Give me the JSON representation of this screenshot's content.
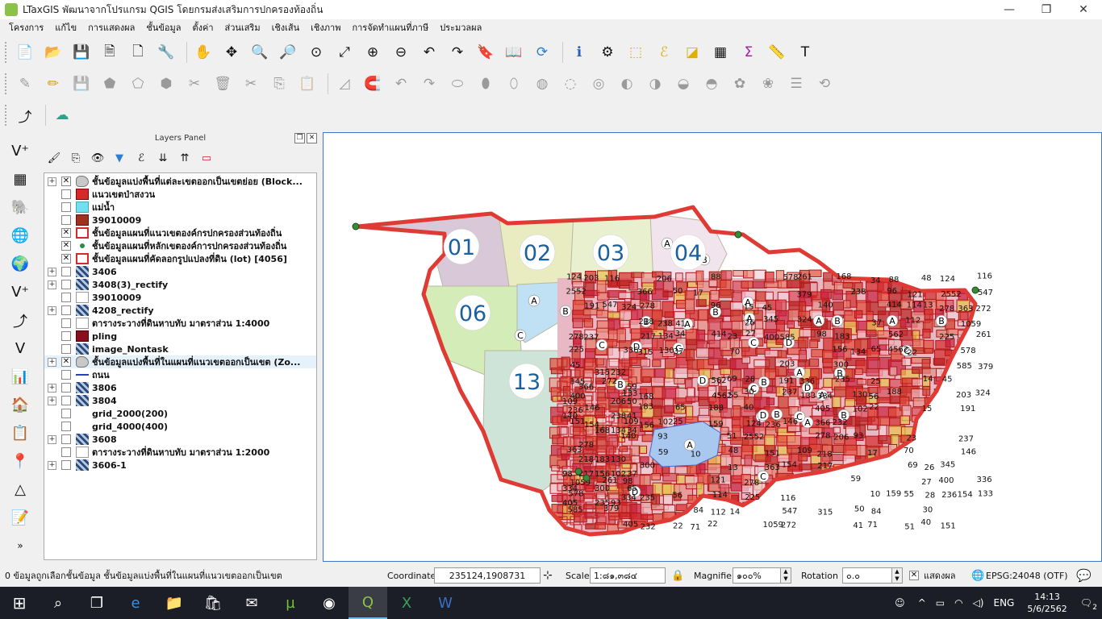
{
  "window": {
    "title": "LTaxGIS พัฒนาจากโปรแกรม QGIS โดยกรมส่งเสริมการปกครองท้องถิ่น",
    "minimize": "—",
    "maximize": "❐",
    "close": "✕"
  },
  "menu": [
    "โครงการ",
    "แก้ไข",
    "การแสดงผล",
    "ชั้นข้อมูล",
    "ตั้งค่า",
    "ส่วนเสริม",
    "เชิงเส้น",
    "เชิงภาพ",
    "การจัดทำแผนที่ภาษี",
    "ประมวลผล"
  ],
  "layers_panel": {
    "title": "Layers Panel",
    "float_btn": "❐",
    "close_btn": "✕",
    "layers": [
      {
        "name": "ชั้นข้อมูลแบ่งพื้นที่แต่ละเขตออกเป็นเขตย่อย (Block...",
        "checked": true,
        "expandable": true,
        "symbol": "polygon-gray"
      },
      {
        "name": "แนวเขตป่าสงวน",
        "checked": false,
        "expandable": false,
        "symbol": "fill-red"
      },
      {
        "name": "แม่น้ำ",
        "checked": false,
        "expandable": false,
        "symbol": "fill-cyan"
      },
      {
        "name": "39010009",
        "checked": false,
        "expandable": false,
        "symbol": "fill-darkred"
      },
      {
        "name": "ชั้นข้อมูลแผนที่แนวเขตองค์กรปกครองส่วนท้องถิ่น",
        "checked": true,
        "expandable": false,
        "symbol": "outline-red"
      },
      {
        "name": "ชั้นข้อมูลแผนที่หลักเขตองค์การปกครองส่วนท้องถิ่น",
        "checked": true,
        "expandable": false,
        "symbol": "dot-green"
      },
      {
        "name": "ชั้นข้อมูลแผนที่คัดลอกรูปแปลงที่ดิน (lot) [4056]",
        "checked": true,
        "expandable": false,
        "symbol": "outline-red"
      },
      {
        "name": "3406",
        "checked": false,
        "expandable": true,
        "symbol": "raster"
      },
      {
        "name": "3408(3)_rectify",
        "checked": false,
        "expandable": true,
        "symbol": "raster"
      },
      {
        "name": "39010009",
        "checked": false,
        "expandable": false,
        "symbol": "fill-white"
      },
      {
        "name": "4208_rectify",
        "checked": false,
        "expandable": true,
        "symbol": "raster"
      },
      {
        "name": "ตารางระวางที่ดินหาบทับ มาตราส่วน 1:4000",
        "checked": false,
        "expandable": false,
        "symbol": "fill-white"
      },
      {
        "name": "pling",
        "checked": false,
        "expandable": false,
        "symbol": "fill-maroon"
      },
      {
        "name": "image_Nontask",
        "checked": false,
        "expandable": false,
        "symbol": "raster"
      },
      {
        "name": "ชั้นข้อมูลแบ่งพื้นที่ในแผนที่แนวเขตออกเป็นเขต (Zo...",
        "checked": true,
        "expandable": true,
        "symbol": "polygon-gray",
        "selected": true
      },
      {
        "name": "ถนน",
        "checked": false,
        "expandable": false,
        "symbol": "line-blue"
      },
      {
        "name": "3806",
        "checked": false,
        "expandable": true,
        "symbol": "raster"
      },
      {
        "name": "3804",
        "checked": false,
        "expandable": true,
        "symbol": "raster"
      },
      {
        "name": "grid_2000(200)",
        "checked": false,
        "expandable": false,
        "symbol": "none"
      },
      {
        "name": "grid_4000(400)",
        "checked": false,
        "expandable": false,
        "symbol": "none"
      },
      {
        "name": "3608",
        "checked": false,
        "expandable": true,
        "symbol": "raster"
      },
      {
        "name": "ตารางระวางที่ดินหาบทับ มาตราส่วน 1:2000",
        "checked": false,
        "expandable": false,
        "symbol": "fill-white"
      },
      {
        "name": "3606-1",
        "checked": false,
        "expandable": true,
        "symbol": "raster"
      }
    ]
  },
  "map": {
    "zones": [
      "01",
      "02",
      "03",
      "04",
      "06",
      "13"
    ],
    "block_labels": [
      "A",
      "B",
      "C",
      "D"
    ],
    "parcel_numbers": [
      "124",
      "2552",
      "278",
      "225",
      "45",
      "345",
      "400",
      "236",
      "151",
      "363",
      "1059",
      "578",
      "585",
      "203",
      "191",
      "237",
      "146",
      "154",
      "116",
      "547",
      "272",
      "261",
      "379",
      "324",
      "336",
      "133",
      "109",
      "140",
      "98",
      "334",
      "405",
      "366",
      "278",
      "218",
      "217",
      "315",
      "168",
      "183",
      "156",
      "300",
      "235",
      "232",
      "206",
      "238",
      "134",
      "130",
      "102",
      "93",
      "59",
      "50",
      "41",
      "34",
      "37",
      "65",
      "25",
      "56",
      "22",
      "17",
      "10",
      "84",
      "71",
      "88",
      "96",
      "414",
      "562",
      "4562",
      "188",
      "159",
      "121",
      "114",
      "112",
      "22",
      "23",
      "70",
      "69",
      "55",
      "51",
      "48",
      "13",
      "14",
      "15",
      "26",
      "27",
      "28",
      "30",
      "40"
    ]
  },
  "status": {
    "message": "0 ข้อมูลถูกเลือกชั้นข้อมูล ชั้นข้อมูลแบ่งพื้นที่ในแผนที่แนวเขตออกเป็นเขต",
    "coordinate_label": "Coordinate",
    "coordinate_value": "235124,1908731",
    "scale_label": "Scale",
    "scale_value": "1:๘๑,๓๘๔",
    "magnifier_label": "Magnifier",
    "magnifier_value": "๑๐๐%",
    "rotation_label": "Rotation",
    "rotation_value": "๐.๐",
    "render_label": "แสดงผล",
    "crs": "EPSG:24048 (OTF)"
  },
  "taskbar": {
    "language": "ENG",
    "time": "14:13",
    "date": "5/6/2562",
    "notifications": "2"
  },
  "colors": {
    "parcel_red": "#d42a2a",
    "boundary_red": "#e03a34",
    "lake_blue": "#a8c8f0",
    "zone01": "#d8c8d8",
    "zone02": "#e8ecc0",
    "zone03": "#e8f0d0",
    "zone06": "#d4ecb8",
    "zone13": "#cfe4d8"
  }
}
